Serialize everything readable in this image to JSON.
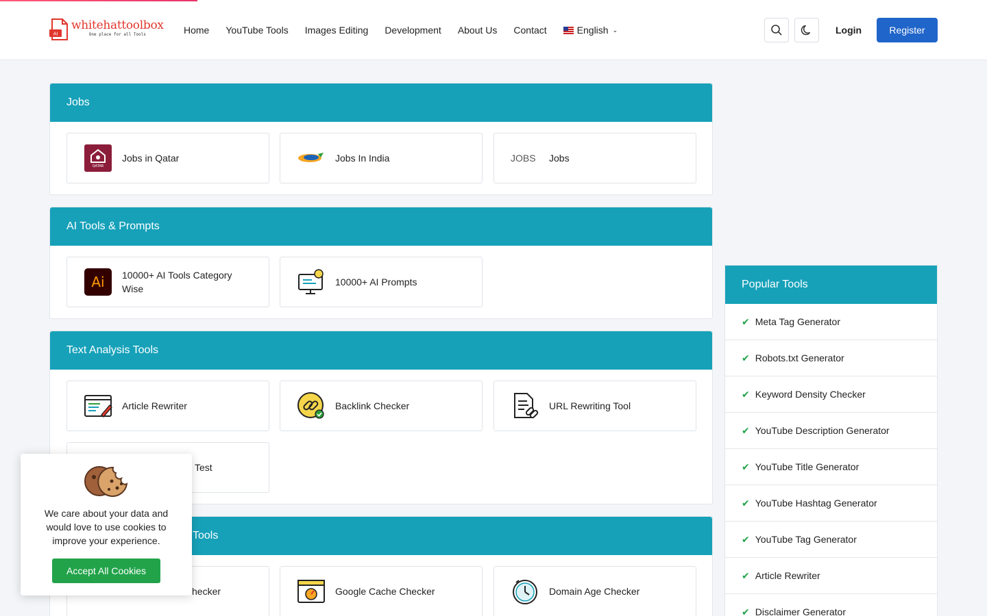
{
  "logo": {
    "name": "whitehattoolbox",
    "tagline": "One place for all Tools",
    "mark_text": "AI"
  },
  "nav": {
    "items": [
      "Home",
      "YouTube Tools",
      "Images Editing",
      "Development",
      "About Us",
      "Contact"
    ],
    "language": "English"
  },
  "header": {
    "login_label": "Login",
    "register_label": "Register"
  },
  "sections": {
    "jobs": {
      "title": "Jobs",
      "tools": [
        "Jobs in Qatar",
        "Jobs In India",
        "Jobs"
      ],
      "broken_img_alt": "JOBS",
      "qatar_text": "QATAR"
    },
    "ai": {
      "title": "AI Tools & Prompts",
      "tools": [
        "10000+ AI Tools Category Wise",
        "10000+ AI Prompts"
      ],
      "ai_logo_text": "Ai"
    },
    "text": {
      "title": "Text Analysis Tools",
      "tools": [
        "Article Rewriter",
        "Backlink Checker",
        "URL Rewriting Tool",
        "Test"
      ]
    },
    "fourth": {
      "title_visible": "Tools",
      "tools": [
        "hecker",
        "Google Cache Checker",
        "Domain Age Checker"
      ]
    }
  },
  "popular": {
    "title": "Popular Tools",
    "items": [
      "Meta Tag Generator",
      "Robots.txt Generator",
      "Keyword Density Checker",
      "YouTube Description Generator",
      "YouTube Title Generator",
      "YouTube Hashtag Generator",
      "YouTube Tag Generator",
      "Article Rewriter",
      "Disclaimer Generator"
    ]
  },
  "cookie": {
    "message": "We care about your data and would love to use cookies to improve your experience.",
    "accept_label": "Accept All Cookies"
  },
  "colors": {
    "accent": "#16a1b9",
    "brand": "#2065c9",
    "success": "#22a34a",
    "logo_red": "#e0362c"
  }
}
